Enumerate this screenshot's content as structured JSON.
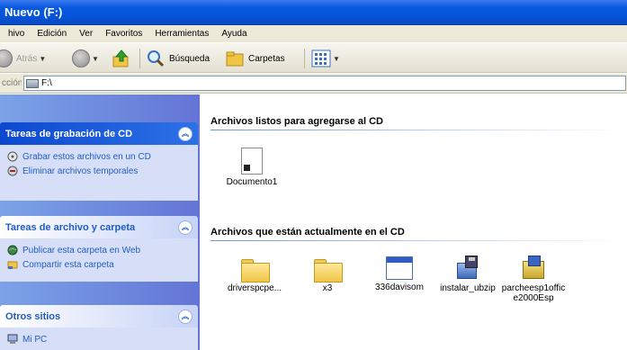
{
  "window": {
    "title": "Nuevo (F:)"
  },
  "menu": [
    "hivo",
    "Edición",
    "Ver",
    "Favoritos",
    "Herramientas",
    "Ayuda"
  ],
  "toolbar": {
    "back_label": "Atrás",
    "search_label": "Búsqueda",
    "folders_label": "Carpetas"
  },
  "address": {
    "label": "cción",
    "path": "F:\\"
  },
  "panels": {
    "cd_tasks": {
      "title": "Tareas de grabación de CD",
      "items": [
        "Grabar estos archivos en un CD",
        "Eliminar archivos temporales"
      ]
    },
    "file_tasks": {
      "title": "Tareas de archivo y carpeta",
      "items": [
        "Publicar esta carpeta en Web",
        "Compartir esta carpeta"
      ]
    },
    "other_places": {
      "title": "Otros sitios",
      "items": [
        "Mi PC"
      ]
    }
  },
  "groups": {
    "ready": {
      "title": "Archivos listos para agregarse al CD",
      "files": [
        {
          "name": "Documento1",
          "icon": "document-icon"
        }
      ]
    },
    "oncd": {
      "title": "Archivos que están actualmente en el CD",
      "files": [
        {
          "name": "driverspcpe...",
          "icon": "folder-icon"
        },
        {
          "name": "x3",
          "icon": "folder-icon"
        },
        {
          "name": "336davisom",
          "icon": "window-app-icon"
        },
        {
          "name": "instalar_ubzip",
          "icon": "installer-icon"
        },
        {
          "name": "parcheesp1offic e2000Esp",
          "icon": "setup-icon"
        }
      ]
    }
  }
}
